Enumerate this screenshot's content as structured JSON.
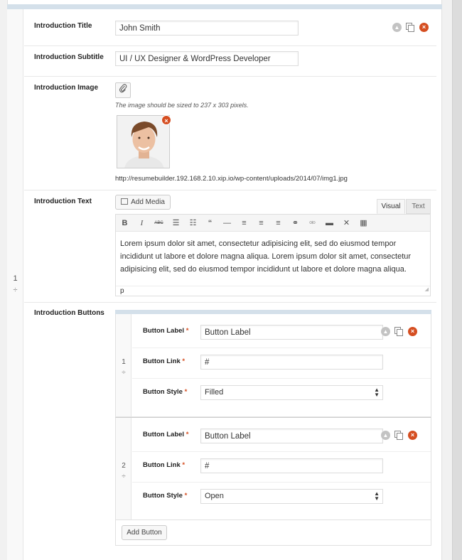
{
  "row": {
    "index": "1",
    "drag_glyph": "÷"
  },
  "fields": {
    "intro_title": {
      "label": "Introduction Title",
      "value": "John Smith"
    },
    "intro_subtitle": {
      "label": "Introduction Subtitle",
      "value": "UI / UX Designer & WordPress Developer"
    },
    "intro_image": {
      "label": "Introduction Image",
      "hint": "The image should be sized to 237 x 303 pixels.",
      "url": "http://resumebuilder.192.168.2.10.xip.io/wp-content/uploads/2014/07/img1.jpg"
    },
    "intro_text": {
      "label": "Introduction Text",
      "add_media_label": "Add Media",
      "tab_visual": "Visual",
      "tab_text": "Text",
      "content": "Lorem ipsum dolor sit amet, consectetur adipisicing elit, sed do eiusmod tempor incididunt ut labore et dolore magna aliqua. Lorem ipsum dolor sit amet, consectetur adipisicing elit, sed do eiusmod tempor incididunt ut labore et dolore magna aliqua.",
      "path": "p"
    },
    "intro_buttons": {
      "label": "Introduction Buttons",
      "items": [
        {
          "index": "1",
          "label_label": "Button Label",
          "label_value": "Button Label",
          "link_label": "Button Link",
          "link_value": "#",
          "style_label": "Button Style",
          "style_value": "Filled"
        },
        {
          "index": "2",
          "label_label": "Button Label",
          "label_value": "Button Label",
          "link_label": "Button Link",
          "link_value": "#",
          "style_label": "Button Style",
          "style_value": "Open"
        }
      ],
      "add_button_label": "Add Button"
    }
  },
  "required_mark": "*",
  "colors": {
    "accent_bar": "#d4e0ea",
    "delete": "#d54e21"
  }
}
